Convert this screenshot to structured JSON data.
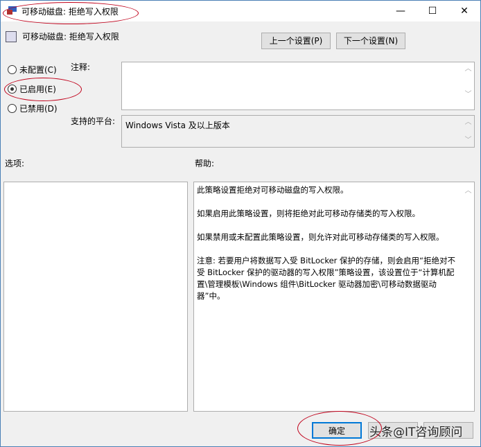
{
  "window": {
    "title": "可移动磁盘: 拒绝写入权限",
    "minimize": "—",
    "maximize": "☐",
    "close": "✕"
  },
  "header": {
    "title": "可移动磁盘: 拒绝写入权限",
    "prev_button": "上一个设置(P)",
    "next_button": "下一个设置(N)"
  },
  "radios": [
    {
      "label": "未配置(C)",
      "checked": false
    },
    {
      "label": "已启用(E)",
      "checked": true
    },
    {
      "label": "已禁用(D)",
      "checked": false
    }
  ],
  "comment_label": "注释:",
  "platform_label": "支持的平台:",
  "platform_value": "Windows Vista 及以上版本",
  "options_label": "选项:",
  "help_label": "帮助:",
  "help_paragraphs": [
    "此策略设置拒绝对可移动磁盘的写入权限。",
    "如果启用此策略设置，则将拒绝对此可移动存储类的写入权限。",
    "如果禁用或未配置此策略设置，则允许对此可移动存储类的写入权限。",
    "注意: 若要用户将数据写入受 BitLocker 保护的存储，则会启用“拒绝对不受 BitLocker 保护的驱动器的写入权限”策略设置，该设置位于“计算机配置\\管理模板\\Windows 组件\\BitLocker 驱动器加密\\可移动数据驱动器”中。"
  ],
  "footer": {
    "ok_button": "确定",
    "watermark": "头条@IT咨询顾问"
  }
}
